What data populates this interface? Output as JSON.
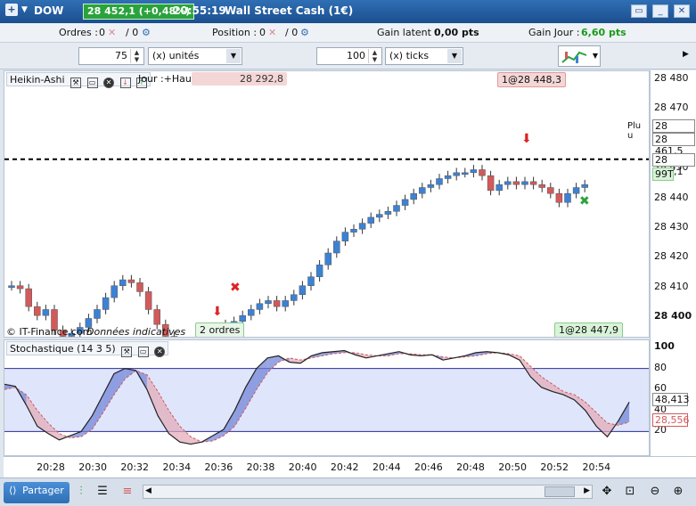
{
  "titlebar": {
    "symbol": "DOW",
    "price_change": "28 452,1 (+0,48%)",
    "time": "20:55:19",
    "instrument": "Wall Street Cash (1€)"
  },
  "info": {
    "orders_label": "Ordres :",
    "orders_value": "0",
    "orders_sep": "/ 0",
    "position_label": "Position :",
    "position_value": "0",
    "position_sep": "/ 0",
    "latent_label": "Gain latent :",
    "latent_value": "0,00 pts",
    "day_label": "Gain Jour :",
    "day_value": "6,60 pts",
    "day_color": "#1a9a1a"
  },
  "toolbar": {
    "qty_value": "75",
    "qty_unit": "(x) unités",
    "ticks_value": "100",
    "ticks_unit": "(x) ticks"
  },
  "main_chart": {
    "header_label": "Heikin-Ashi",
    "jour_text": "Jour :+Haut 28",
    "overlay_text": "28 292,8",
    "sell_tag": "1@28 448,3",
    "buy_tag": "1@28 447,9",
    "orders_tag": "2 ordres",
    "copyright": "© IT-Finance.com",
    "disclaimer": "Données indicatives",
    "hline_label": "Plu u",
    "axis_labels": [
      "28 480",
      "28 470",
      "28 460",
      "28 450",
      "28 440",
      "28 430",
      "28 420",
      "28 410",
      "28 400"
    ],
    "price_tags": {
      "p1": "28 461,6",
      "p2": "28 461,5",
      "last": "28 452,1",
      "timer": "99T"
    }
  },
  "stoch_chart": {
    "header_label": "Stochastique (14 3 5)",
    "axis_labels": [
      "100",
      "80",
      "60",
      "40",
      "20"
    ],
    "k_value": "48,413",
    "d_value": "28,556",
    "upper_level": 80,
    "lower_level": 20
  },
  "time_axis": [
    "20:28",
    "20:30",
    "20:32",
    "20:34",
    "20:36",
    "20:38",
    "20:40",
    "20:42",
    "20:44",
    "20:46",
    "20:48",
    "20:50",
    "20:52",
    "20:54"
  ],
  "statusbar": {
    "share_label": "Partager"
  },
  "colors": {
    "bull": "#3b82d6",
    "bear": "#d25a5a",
    "k_line": "#222222",
    "d_line": "#d25a5a",
    "fill_up": "#6b7fd6",
    "fill_down": "#e2a8b6"
  }
}
